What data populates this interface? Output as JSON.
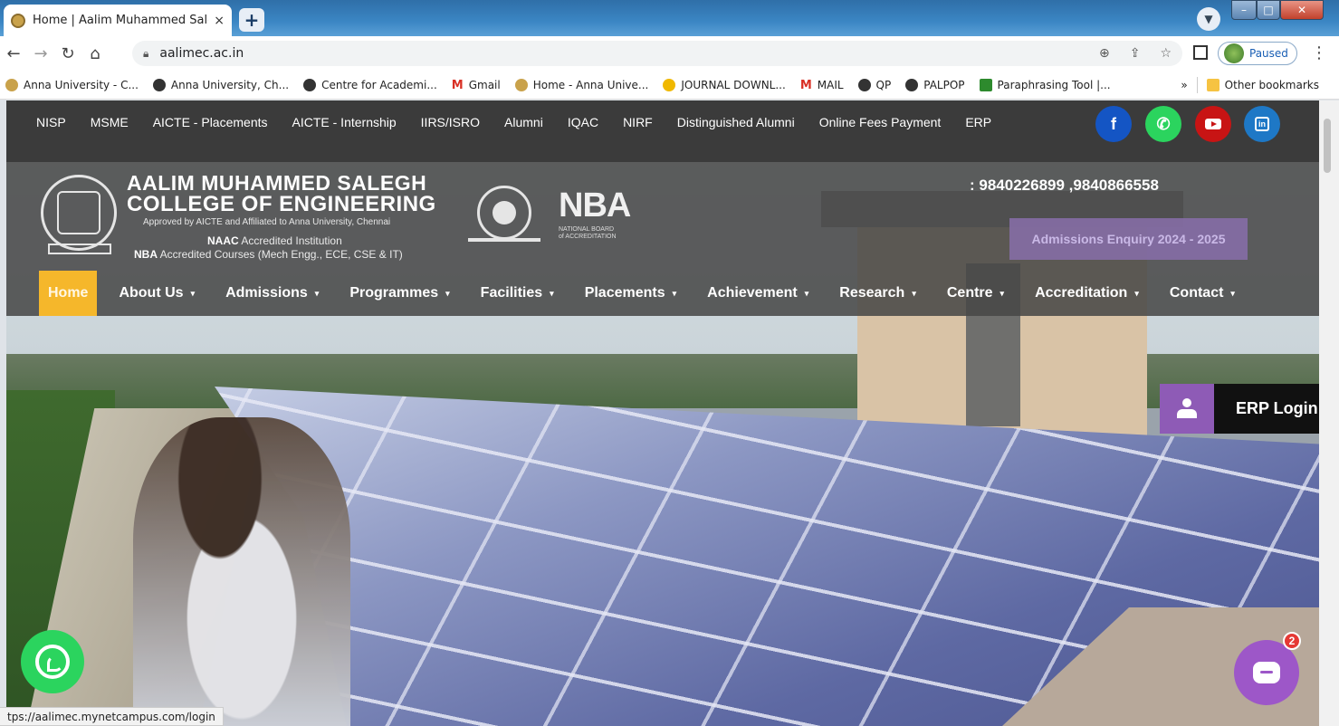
{
  "browser": {
    "tab_title": "Home | Aalim Muhammed Salegh",
    "tab_close": "×",
    "new_tab": "+",
    "url": "aalimec.ac.in",
    "profile_label": "Paused",
    "bookmarks": [
      {
        "label": "Anna University - C...",
        "icon": "anna"
      },
      {
        "label": "Anna University, Ch...",
        "icon": "globe"
      },
      {
        "label": "Centre for Academi...",
        "icon": "globe"
      },
      {
        "label": "Gmail",
        "icon": "gmail"
      },
      {
        "label": "Home - Anna Unive...",
        "icon": "anna"
      },
      {
        "label": "JOURNAL DOWNL...",
        "icon": "journal"
      },
      {
        "label": "MAIL",
        "icon": "gmail"
      },
      {
        "label": "QP",
        "icon": "globe"
      },
      {
        "label": "PALPOP",
        "icon": "globe"
      },
      {
        "label": "Paraphrasing Tool |...",
        "icon": "para"
      }
    ],
    "more_bookmarks": "»",
    "other_bookmarks": "Other bookmarks",
    "status_url": "tps://aalimec.mynetcampus.com/login"
  },
  "site": {
    "top_links": [
      "NISP",
      "MSME",
      "AICTE - Placements",
      "AICTE - Internship",
      "IIRS/ISRO",
      "Alumni",
      "IQAC",
      "NIRF",
      "Distinguished Alumni",
      "Online Fees Payment",
      "ERP"
    ],
    "social": {
      "facebook": "f",
      "linkedin": "in"
    },
    "college_line1": "AALIM MUHAMMED SALEGH",
    "college_line2": "COLLEGE OF ENGINEERING",
    "approved": "Approved by AICTE and Affiliated to Anna University, Chennai",
    "naac_bold": "NAAC",
    "naac_rest": " Accredited Institution",
    "nba_bold": "NBA",
    "nba_rest": " Accredited Courses (Mech Engg., ECE, CSE & IT)",
    "nba_logo_text": "NBA",
    "nba_logo_sub1": "NATIONAL BOARD",
    "nba_logo_sub2": "of ACCREDITATION",
    "phones": ": 9840226899 ,9840866558",
    "enquiry": "Admissions Enquiry 2024 - 2025",
    "nav": [
      {
        "label": "Home",
        "dropdown": false,
        "active": true
      },
      {
        "label": "About Us",
        "dropdown": true
      },
      {
        "label": "Admissions",
        "dropdown": true
      },
      {
        "label": "Programmes",
        "dropdown": true
      },
      {
        "label": "Facilities",
        "dropdown": true
      },
      {
        "label": "Placements",
        "dropdown": true
      },
      {
        "label": "Achievement",
        "dropdown": true
      },
      {
        "label": "Research",
        "dropdown": true
      },
      {
        "label": "Centre",
        "dropdown": true
      },
      {
        "label": "Accreditation",
        "dropdown": true
      },
      {
        "label": "Contact",
        "dropdown": true
      }
    ],
    "nav_caret": "▾",
    "erp_login": "ERP Login",
    "chat_badge": "2"
  },
  "colors": {
    "nav_active": "#f5b72b",
    "erp_icon_bg": "#8e5bb6",
    "chat_bg": "#9d57c8",
    "whatsapp": "#2bd45e",
    "facebook": "#1455c4",
    "youtube": "#c81414",
    "linkedin": "#1e78c6"
  }
}
